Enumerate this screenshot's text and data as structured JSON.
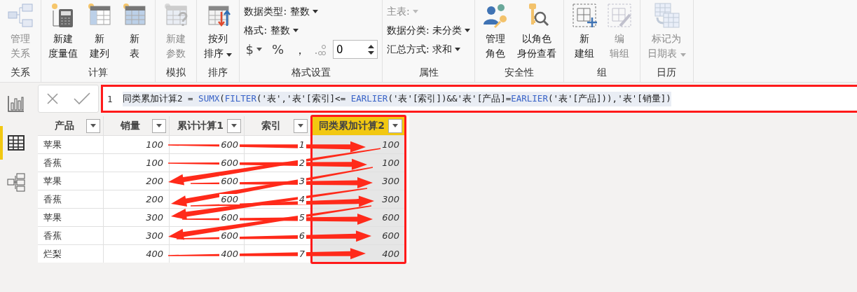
{
  "ribbon": {
    "groups": [
      {
        "label": "关系",
        "buttons": [
          {
            "lines": [
              "管理",
              "关系"
            ],
            "disabled": true
          }
        ]
      },
      {
        "label": "计算",
        "buttons": [
          {
            "lines": [
              "新建",
              "度量值"
            ],
            "disabled": false
          },
          {
            "lines": [
              "新",
              "建列"
            ],
            "disabled": false
          },
          {
            "lines": [
              "新",
              "表"
            ],
            "disabled": false
          }
        ]
      },
      {
        "label": "模拟",
        "buttons": [
          {
            "lines": [
              "新建",
              "参数"
            ],
            "disabled": true
          }
        ]
      },
      {
        "label": "排序",
        "buttons": [
          {
            "lines": [
              "按列",
              "排序"
            ],
            "disabled": false,
            "dropdown": true
          }
        ]
      },
      {
        "label": "格式设置",
        "kind": "format",
        "dropdowns": [
          {
            "text": "数据类型: 整数",
            "disabled": false
          },
          {
            "text": "格式: 整数",
            "disabled": false
          }
        ],
        "symbols": [
          "$",
          "%",
          "，"
        ],
        "decimals": "0"
      },
      {
        "label": "属性",
        "kind": "properties",
        "dropdowns": [
          {
            "text": "主表:",
            "disabled": true
          },
          {
            "text": "数据分类: 未分类",
            "disabled": false
          },
          {
            "text": "汇总方式: 求和",
            "disabled": false
          }
        ]
      },
      {
        "label": "安全性",
        "buttons": [
          {
            "lines": [
              "管理",
              "角色"
            ],
            "disabled": false
          },
          {
            "lines": [
              "以角色",
              "身份查看"
            ],
            "disabled": false
          }
        ]
      },
      {
        "label": "组",
        "buttons": [
          {
            "lines": [
              "新",
              "建组"
            ],
            "disabled": false
          },
          {
            "lines": [
              "编",
              "辑组"
            ],
            "disabled": true
          }
        ]
      },
      {
        "label": "日历",
        "buttons": [
          {
            "lines": [
              "标记为",
              "日期表"
            ],
            "disabled": true,
            "dropdown": true
          }
        ]
      }
    ]
  },
  "sidebar": {
    "items": [
      {
        "selected": false
      },
      {
        "selected": true
      },
      {
        "selected": false
      }
    ]
  },
  "formula": {
    "line_number": "1",
    "tokens": [
      {
        "text": "同类累加计算2 = ",
        "kind": "plain"
      },
      {
        "text": "SUMX",
        "kind": "function"
      },
      {
        "text": "(",
        "kind": "plain"
      },
      {
        "text": "FILTER",
        "kind": "function"
      },
      {
        "text": "('表','表'[索引]<= ",
        "kind": "plain"
      },
      {
        "text": "EARLIER",
        "kind": "function"
      },
      {
        "text": "('表'[索引])&&'表'[产品]=",
        "kind": "plain"
      },
      {
        "text": "EARLIER",
        "kind": "function"
      },
      {
        "text": "('表'[产品])),'表'[销量])",
        "kind": "plain"
      }
    ]
  },
  "table": {
    "columns": [
      {
        "label": "产品",
        "selected": false
      },
      {
        "label": "销量",
        "selected": false
      },
      {
        "label": "累计计算1",
        "selected": false
      },
      {
        "label": "索引",
        "selected": false
      },
      {
        "label": "同类累加计算2",
        "selected": true
      }
    ],
    "rows": [
      [
        "苹果",
        "100",
        "600",
        "1",
        "100"
      ],
      [
        "香蕉",
        "100",
        "600",
        "2",
        "100"
      ],
      [
        "苹果",
        "200",
        "600",
        "3",
        "300"
      ],
      [
        "香蕉",
        "200",
        "600",
        "4",
        "300"
      ],
      [
        "苹果",
        "300",
        "600",
        "5",
        "600"
      ],
      [
        "香蕉",
        "300",
        "600",
        "6",
        "600"
      ],
      [
        "烂梨",
        "400",
        "400",
        "7",
        "400"
      ]
    ]
  }
}
